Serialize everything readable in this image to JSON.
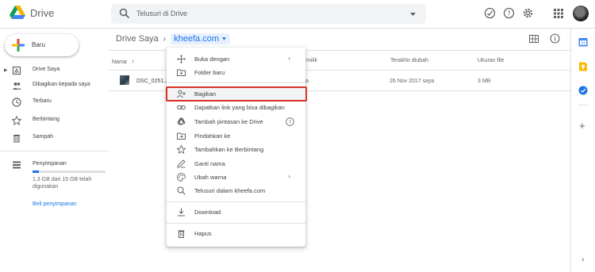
{
  "header": {
    "app_title": "Drive",
    "search_placeholder": "Telusuri di Drive",
    "icons": [
      "drive-logo-icon",
      "search-icon",
      "search-options-icon",
      "support-status-icon",
      "help-icon",
      "settings-icon",
      "apps-icon",
      "avatar"
    ]
  },
  "sidebar": {
    "new_label": "Baru",
    "items": [
      {
        "label": "Drive Saya",
        "icon": "my-drive-icon"
      },
      {
        "label": "Dibagikan kepada saya",
        "icon": "shared-icon"
      },
      {
        "label": "Terbaru",
        "icon": "recent-icon"
      },
      {
        "label": "Berbintang",
        "icon": "star-icon"
      },
      {
        "label": "Sampah",
        "icon": "trash-icon"
      }
    ],
    "storage": {
      "label": "Penyimpanan",
      "text": "1,3 GB dari 15 GB telah digunakan",
      "used_fraction": 0.087,
      "buy_link": "Beli penyimpanan"
    }
  },
  "main": {
    "breadcrumb": {
      "root": "Drive Saya",
      "current": "kheefa.com"
    },
    "columns": {
      "name": "Nama",
      "owner_partial": "milik",
      "modified": "Terakhir diubah",
      "size": "Ukuran file"
    },
    "rows": [
      {
        "name": "DSC_0251.J",
        "owner_partial": "a",
        "modified": "26 Nov 2017",
        "modified_by": "saya",
        "size": "3 MB"
      }
    ]
  },
  "menu": {
    "items": [
      {
        "label": "Buka dengan",
        "icon": "open-with-icon",
        "submenu": true
      },
      {
        "label": "Folder baru",
        "icon": "new-folder-icon"
      },
      {
        "label": "Bagikan",
        "icon": "share-icon",
        "highlighted": true
      },
      {
        "label": "Dapatkan link yang bisa dibagikan",
        "icon": "link-icon"
      },
      {
        "label": "Tambah pintasan ke Drive",
        "icon": "add-shortcut-icon",
        "help": true
      },
      {
        "label": "Pindahkan ke",
        "icon": "move-icon"
      },
      {
        "label": "Tambahkan ke Berbintang",
        "icon": "star-icon"
      },
      {
        "label": "Ganti nama",
        "icon": "rename-icon"
      },
      {
        "label": "Ubah warna",
        "icon": "palette-icon",
        "submenu": true
      },
      {
        "label": "Telusuri dalam kheefa.com",
        "icon": "search-icon"
      },
      {
        "label": "Download",
        "icon": "download-icon"
      },
      {
        "label": "Hapus",
        "icon": "trash-icon"
      }
    ],
    "highlight_color": "#d93025"
  },
  "right_panel": {
    "icons": [
      "calendar-icon",
      "keep-icon",
      "tasks-icon",
      "add-addon-icon",
      "expand-panel-icon"
    ]
  },
  "colors": {
    "accent": "#1a73e8",
    "drive_green": "#0f9d58",
    "drive_yellow": "#f4b400",
    "drive_blue": "#4285f4"
  }
}
